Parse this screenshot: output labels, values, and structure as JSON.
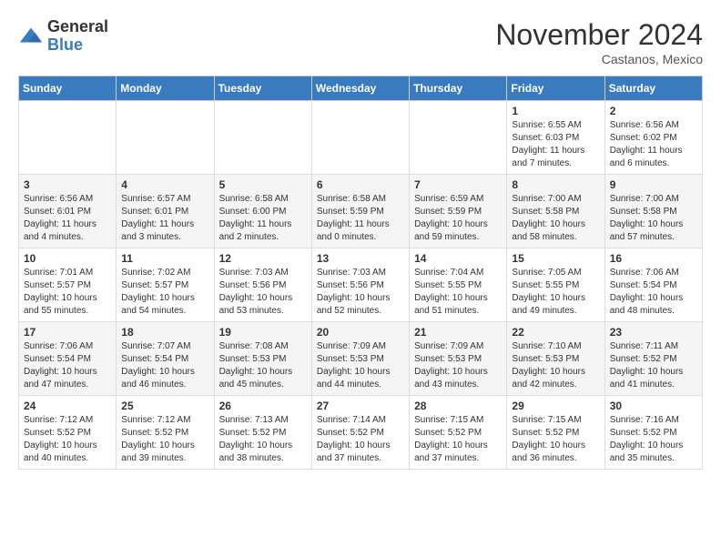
{
  "logo": {
    "general": "General",
    "blue": "Blue"
  },
  "header": {
    "title": "November 2024",
    "subtitle": "Castanos, Mexico"
  },
  "weekdays": [
    "Sunday",
    "Monday",
    "Tuesday",
    "Wednesday",
    "Thursday",
    "Friday",
    "Saturday"
  ],
  "weeks": [
    [
      {
        "day": "",
        "info": ""
      },
      {
        "day": "",
        "info": ""
      },
      {
        "day": "",
        "info": ""
      },
      {
        "day": "",
        "info": ""
      },
      {
        "day": "",
        "info": ""
      },
      {
        "day": "1",
        "info": "Sunrise: 6:55 AM\nSunset: 6:03 PM\nDaylight: 11 hours and 7 minutes."
      },
      {
        "day": "2",
        "info": "Sunrise: 6:56 AM\nSunset: 6:02 PM\nDaylight: 11 hours and 6 minutes."
      }
    ],
    [
      {
        "day": "3",
        "info": "Sunrise: 6:56 AM\nSunset: 6:01 PM\nDaylight: 11 hours and 4 minutes."
      },
      {
        "day": "4",
        "info": "Sunrise: 6:57 AM\nSunset: 6:01 PM\nDaylight: 11 hours and 3 minutes."
      },
      {
        "day": "5",
        "info": "Sunrise: 6:58 AM\nSunset: 6:00 PM\nDaylight: 11 hours and 2 minutes."
      },
      {
        "day": "6",
        "info": "Sunrise: 6:58 AM\nSunset: 5:59 PM\nDaylight: 11 hours and 0 minutes."
      },
      {
        "day": "7",
        "info": "Sunrise: 6:59 AM\nSunset: 5:59 PM\nDaylight: 10 hours and 59 minutes."
      },
      {
        "day": "8",
        "info": "Sunrise: 7:00 AM\nSunset: 5:58 PM\nDaylight: 10 hours and 58 minutes."
      },
      {
        "day": "9",
        "info": "Sunrise: 7:00 AM\nSunset: 5:58 PM\nDaylight: 10 hours and 57 minutes."
      }
    ],
    [
      {
        "day": "10",
        "info": "Sunrise: 7:01 AM\nSunset: 5:57 PM\nDaylight: 10 hours and 55 minutes."
      },
      {
        "day": "11",
        "info": "Sunrise: 7:02 AM\nSunset: 5:57 PM\nDaylight: 10 hours and 54 minutes."
      },
      {
        "day": "12",
        "info": "Sunrise: 7:03 AM\nSunset: 5:56 PM\nDaylight: 10 hours and 53 minutes."
      },
      {
        "day": "13",
        "info": "Sunrise: 7:03 AM\nSunset: 5:56 PM\nDaylight: 10 hours and 52 minutes."
      },
      {
        "day": "14",
        "info": "Sunrise: 7:04 AM\nSunset: 5:55 PM\nDaylight: 10 hours and 51 minutes."
      },
      {
        "day": "15",
        "info": "Sunrise: 7:05 AM\nSunset: 5:55 PM\nDaylight: 10 hours and 49 minutes."
      },
      {
        "day": "16",
        "info": "Sunrise: 7:06 AM\nSunset: 5:54 PM\nDaylight: 10 hours and 48 minutes."
      }
    ],
    [
      {
        "day": "17",
        "info": "Sunrise: 7:06 AM\nSunset: 5:54 PM\nDaylight: 10 hours and 47 minutes."
      },
      {
        "day": "18",
        "info": "Sunrise: 7:07 AM\nSunset: 5:54 PM\nDaylight: 10 hours and 46 minutes."
      },
      {
        "day": "19",
        "info": "Sunrise: 7:08 AM\nSunset: 5:53 PM\nDaylight: 10 hours and 45 minutes."
      },
      {
        "day": "20",
        "info": "Sunrise: 7:09 AM\nSunset: 5:53 PM\nDaylight: 10 hours and 44 minutes."
      },
      {
        "day": "21",
        "info": "Sunrise: 7:09 AM\nSunset: 5:53 PM\nDaylight: 10 hours and 43 minutes."
      },
      {
        "day": "22",
        "info": "Sunrise: 7:10 AM\nSunset: 5:53 PM\nDaylight: 10 hours and 42 minutes."
      },
      {
        "day": "23",
        "info": "Sunrise: 7:11 AM\nSunset: 5:52 PM\nDaylight: 10 hours and 41 minutes."
      }
    ],
    [
      {
        "day": "24",
        "info": "Sunrise: 7:12 AM\nSunset: 5:52 PM\nDaylight: 10 hours and 40 minutes."
      },
      {
        "day": "25",
        "info": "Sunrise: 7:12 AM\nSunset: 5:52 PM\nDaylight: 10 hours and 39 minutes."
      },
      {
        "day": "26",
        "info": "Sunrise: 7:13 AM\nSunset: 5:52 PM\nDaylight: 10 hours and 38 minutes."
      },
      {
        "day": "27",
        "info": "Sunrise: 7:14 AM\nSunset: 5:52 PM\nDaylight: 10 hours and 37 minutes."
      },
      {
        "day": "28",
        "info": "Sunrise: 7:15 AM\nSunset: 5:52 PM\nDaylight: 10 hours and 37 minutes."
      },
      {
        "day": "29",
        "info": "Sunrise: 7:15 AM\nSunset: 5:52 PM\nDaylight: 10 hours and 36 minutes."
      },
      {
        "day": "30",
        "info": "Sunrise: 7:16 AM\nSunset: 5:52 PM\nDaylight: 10 hours and 35 minutes."
      }
    ]
  ]
}
